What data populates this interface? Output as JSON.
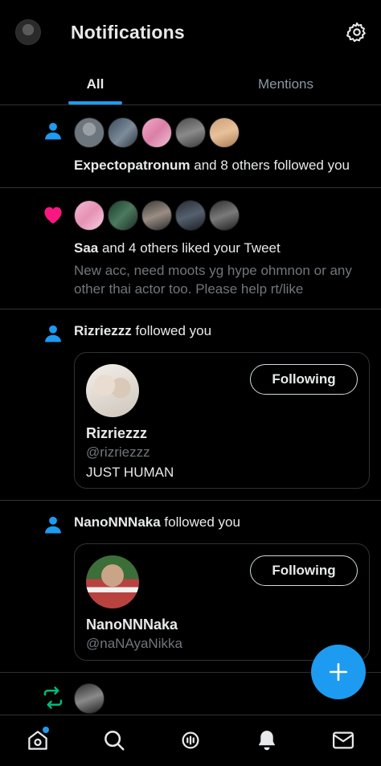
{
  "header": {
    "title": "Notifications",
    "settings_icon": "gear-icon",
    "profile_icon": "avatar"
  },
  "tabs": [
    {
      "label": "All",
      "selected": true
    },
    {
      "label": "Mentions",
      "selected": false
    }
  ],
  "colors": {
    "accent": "#1d9bf0",
    "like": "#f91880",
    "retweet": "#00ba7c",
    "follow_icon": "#1d9bf0",
    "secondary_text": "#71767b"
  },
  "notifications": [
    {
      "type": "follow",
      "icon": "person-icon",
      "actor": "Expectopatronum",
      "rest": " and 8 others followed you"
    },
    {
      "type": "like",
      "icon": "heart-icon",
      "actor": "Saa",
      "rest": " and 4 others liked your Tweet",
      "preview": "New acc, need moots yg hype ohmnon or any other thai actor too. Please help rt/like"
    },
    {
      "type": "follow",
      "icon": "person-icon",
      "actor": "Rizriezzz",
      "rest": " followed you",
      "card": {
        "name": "Rizriezzz",
        "handle": "@rizriezzz",
        "bio": "JUST HUMAN",
        "button": "Following"
      }
    },
    {
      "type": "follow",
      "icon": "person-icon",
      "actor": "NanoNNNaka",
      "rest": " followed you",
      "card": {
        "name": "NanoNNNaka",
        "handle": "@naNAyaNikka",
        "button": "Following"
      }
    },
    {
      "type": "retweet",
      "icon": "retweet-icon"
    }
  ],
  "fab": {
    "icon": "compose-plus-icon"
  },
  "bottom_nav": [
    {
      "icon": "home-icon",
      "has_dot": true
    },
    {
      "icon": "search-icon"
    },
    {
      "icon": "spaces-icon"
    },
    {
      "icon": "bell-icon",
      "active": true
    },
    {
      "icon": "mail-icon"
    }
  ]
}
